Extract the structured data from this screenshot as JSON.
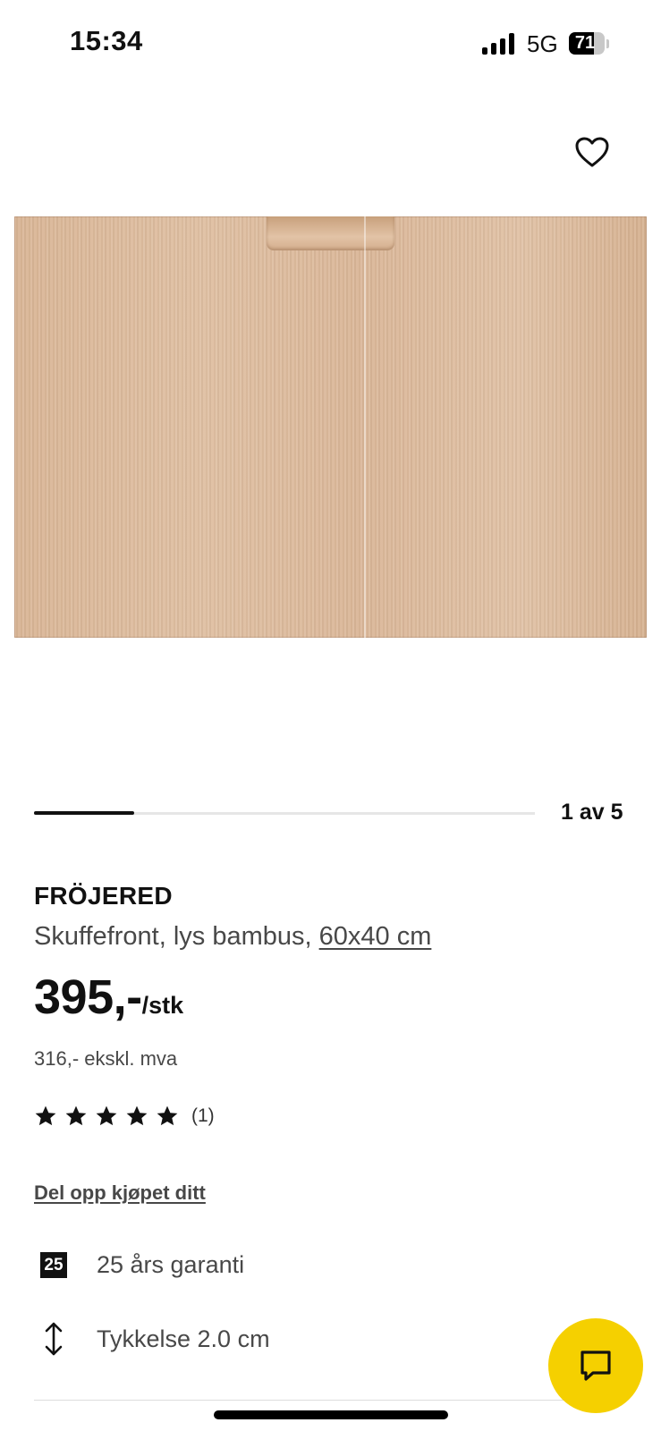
{
  "status_bar": {
    "time": "15:34",
    "network": "5G",
    "battery_percent": 71
  },
  "gallery": {
    "current": 1,
    "total": 5,
    "counter_text": "1 av 5"
  },
  "product": {
    "name": "FRÖJERED",
    "description": "Skuffefront, lys bambus, ",
    "size": "60x40 cm",
    "price": "395,-",
    "price_unit": "/stk",
    "price_ex_vat": "316,- ekskl. mva",
    "rating": {
      "stars": 5,
      "max": 5,
      "count_text": "(1)"
    }
  },
  "links": {
    "split_payment": "Del opp kjøpet ditt"
  },
  "features": [
    {
      "icon": "warranty-25-icon",
      "badge": "25",
      "label": "25 års garanti"
    },
    {
      "icon": "vertical-arrows-icon",
      "label": "Tykkelse 2.0 cm"
    }
  ],
  "icons": {
    "favorite": "heart-icon",
    "chat": "chat-bubble-icon"
  },
  "colors": {
    "chat_button": "#f5d000",
    "text_secondary": "#484848"
  }
}
